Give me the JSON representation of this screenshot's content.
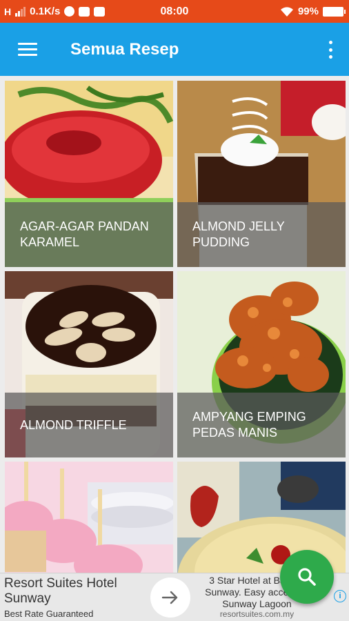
{
  "status_bar": {
    "signal_label": "H",
    "network_speed": "0.1K/s",
    "time": "08:00",
    "battery": "99%"
  },
  "app_bar": {
    "title": "Semua Resep",
    "menu_icon": "hamburger-menu-icon",
    "overflow_icon": "more-vert-icon",
    "background": "#1aa0e6"
  },
  "recipes": [
    {
      "title": "AGAR-AGAR PANDAN KARAMEL"
    },
    {
      "title": "ALMOND JELLY PUDDING"
    },
    {
      "title": "ALMOND TRIFFLE"
    },
    {
      "title": "AMPYANG EMPING PEDAS MANIS"
    },
    {
      "title": ""
    },
    {
      "title": ""
    }
  ],
  "ad": {
    "title": "Resort Suites Hotel Sunway",
    "subtitle": "Best Rate Guaranteed",
    "description": "3 Star Hotel at Bandar Sunway. Easy access to Sunway Lagoon",
    "url": "resortsuites.com.my"
  },
  "fab": {
    "icon": "search-icon",
    "color": "#2eaa4b"
  },
  "colors": {
    "status_bar": "#e64a19",
    "caption_overlay": "rgba(90,90,90,0.72)"
  }
}
